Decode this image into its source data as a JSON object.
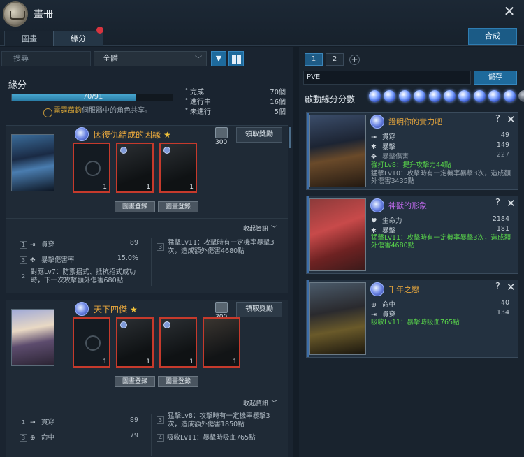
{
  "header": {
    "title": "畫冊",
    "close": "✕",
    "tabs": [
      "圖畫",
      "緣分"
    ],
    "synth_button": "合成"
  },
  "filter": {
    "search_placeholder": "搜尋",
    "select_value": "全體",
    "filter_icon": "filter-icon",
    "grid_icon": "grid-view-icon"
  },
  "summary": {
    "title": "緣分",
    "progress_text": "70/91",
    "progress_fraction": 0.769,
    "notice_prefix": "雷霆萬鈞",
    "notice_suffix": "伺服器中的角色共享。",
    "stats": [
      {
        "label": "完成",
        "value": "70個"
      },
      {
        "label": "進行中",
        "value": "16個"
      },
      {
        "label": "未進行",
        "value": "5個"
      }
    ]
  },
  "cards": [
    {
      "title": "因復仇結成的因緣",
      "star": "★",
      "points": "300",
      "claim": "領取獎勵",
      "slot_counts": [
        "1",
        "1",
        "1"
      ],
      "register_labels": [
        "圖畫登錄",
        "圖畫登錄"
      ],
      "collapse": "收起資訊",
      "effects": [
        {
          "idx": "1",
          "label": "貫穿",
          "value": "89"
        },
        {
          "idx": "3",
          "label": "暴擊傷害率",
          "value": "15.0%"
        },
        {
          "idx": "2",
          "label": "對應Lv7：防禦招式、抵抗招式成功時，下一次攻擊額外傷害680點"
        }
      ],
      "effects_right": [
        {
          "idx": "3",
          "label": "猛擊Lv11：攻擊時有一定機率暴擊3次，造成額外傷害4680點"
        }
      ]
    },
    {
      "title": "天下四傑",
      "star": "★",
      "points": "300",
      "claim": "領取獎勵",
      "slot_counts": [
        "1",
        "1",
        "1",
        "1"
      ],
      "register_labels": [
        "圖畫登錄",
        "圖畫登錄"
      ],
      "collapse": "收起資訊",
      "effects": [
        {
          "idx": "1",
          "label": "貫穿",
          "value": "89"
        },
        {
          "idx": "3",
          "label": "命中",
          "value": "79"
        }
      ],
      "effects_right": [
        {
          "idx": "3",
          "label": "猛擊Lv8：攻擊時有一定機率暴擊3次，造成額外傷害1850點"
        },
        {
          "idx": "4",
          "label": "吸收Lv11：暴擊時吸血765點"
        }
      ]
    }
  ],
  "right": {
    "pages": [
      "1",
      "2"
    ],
    "add": "+",
    "preset_name": "PVE",
    "save": "儲存",
    "score_label": "啟動緣分分數",
    "orbs_active": 10,
    "orbs_total": 11,
    "cards": [
      {
        "title": "證明你的實力吧",
        "title_color": "#e9a83d",
        "q": "?",
        "x": "✕",
        "stats": [
          {
            "label": "貫穿",
            "value": "49"
          },
          {
            "label": "暴擊",
            "value": "149"
          },
          {
            "label": "暴擊傷害",
            "value": "227"
          }
        ],
        "green": "強打Lv8：提升攻擊力44點",
        "grey": "猛擊Lv10：攻擊時有一定機率暴擊3次，造成額外傷害3435點"
      },
      {
        "title": "神獸的形象",
        "title_color": "#c36bf0",
        "q": "?",
        "x": "✕",
        "stats": [
          {
            "label": "生命力",
            "value": "2184"
          },
          {
            "label": "暴擊",
            "value": "181"
          }
        ],
        "green": "猛擊Lv11：攻擊時有一定機率暴擊3次，造成額外傷害4680點"
      },
      {
        "title": "千年之戀",
        "title_color": "#e9a83d",
        "q": "?",
        "x": "✕",
        "stats": [
          {
            "label": "命中",
            "value": "40"
          },
          {
            "label": "貫穿",
            "value": "134"
          }
        ],
        "green": "吸收Lv11：暴擊時吸血765點"
      }
    ]
  }
}
